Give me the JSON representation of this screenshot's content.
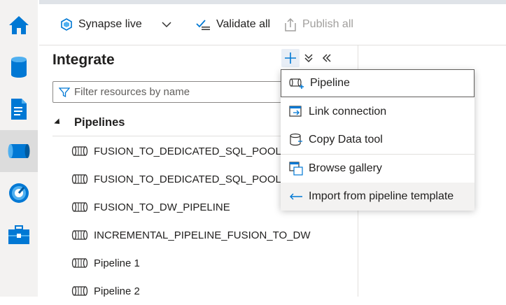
{
  "toolbar": {
    "synapse_live": "Synapse live",
    "validate_all": "Validate all",
    "publish_all": "Publish all"
  },
  "panel": {
    "title": "Integrate",
    "filter_placeholder": "Filter resources by name"
  },
  "pipelines": {
    "header": "Pipelines",
    "items": [
      {
        "label": "FUSION_TO_DEDICATED_SQL_POOL_U"
      },
      {
        "label": "FUSION_TO_DEDICATED_SQL_POOL_U"
      },
      {
        "label": "FUSION_TO_DW_PIPELINE"
      },
      {
        "label": "INCREMENTAL_PIPELINE_FUSION_TO_DW"
      },
      {
        "label": "Pipeline 1"
      },
      {
        "label": "Pipeline 2"
      }
    ]
  },
  "menu": {
    "items": [
      {
        "label": "Pipeline",
        "icon": "pipeline-add-icon"
      },
      {
        "label": "Link connection",
        "icon": "link-connection-icon"
      },
      {
        "label": "Copy Data tool",
        "icon": "copy-data-icon"
      },
      {
        "label": "Browse gallery",
        "icon": "gallery-icon"
      },
      {
        "label": "Import from pipeline template",
        "icon": "import-arrow-icon"
      }
    ]
  },
  "colors": {
    "accent": "#0078d4",
    "rail": "#f3f2f1"
  }
}
